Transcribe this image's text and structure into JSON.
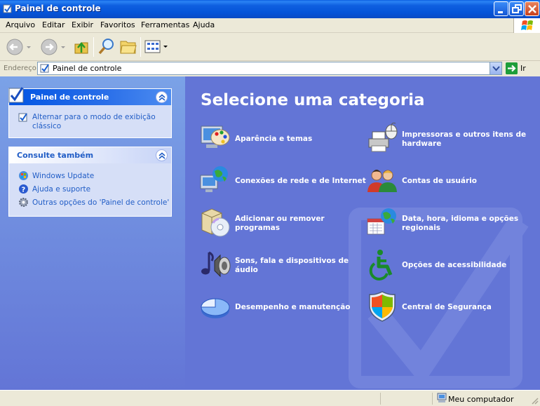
{
  "window": {
    "title": "Painel de controle",
    "icon": "control-panel-icon"
  },
  "menu": {
    "items": [
      {
        "label": "Arquivo"
      },
      {
        "label": "Editar"
      },
      {
        "label": "Exibir"
      },
      {
        "label": "Favoritos"
      },
      {
        "label": "Ferramentas"
      },
      {
        "label": "Ajuda"
      }
    ]
  },
  "toolbar": {
    "buttons": [
      "back-icon",
      "forward-icon",
      "up-folder-icon",
      "search-icon",
      "folders-icon",
      "views-icon"
    ]
  },
  "address": {
    "label": "Endereço",
    "value": "Painel de controle",
    "go_label": "Ir"
  },
  "sidebar": {
    "control_panel": {
      "title": "Painel de controle",
      "link": "Alternar para o modo de exibição clássico"
    },
    "see_also": {
      "title": "Consulte também",
      "links": [
        {
          "label": "Windows Update",
          "icon": "windows-update-icon"
        },
        {
          "label": "Ajuda e suporte",
          "icon": "help-icon"
        },
        {
          "label": "Outras opções do 'Painel de controle'",
          "icon": "gear-icon"
        }
      ]
    }
  },
  "main": {
    "heading": "Selecione uma categoria",
    "categories": [
      {
        "label": "Aparência e temas",
        "icon": "appearance-icon"
      },
      {
        "label": "Impressoras e outros itens de hardware",
        "icon": "printer-icon"
      },
      {
        "label": "Conexões de rede e de Internet",
        "icon": "network-icon"
      },
      {
        "label": "Contas de usuário",
        "icon": "user-accounts-icon"
      },
      {
        "label": "Adicionar ou remover programas",
        "icon": "add-remove-icon"
      },
      {
        "label": "Data, hora, idioma e opções regionais",
        "icon": "date-time-icon"
      },
      {
        "label": "Sons, fala e dispositivos de áudio",
        "icon": "sounds-icon"
      },
      {
        "label": "Opções de acessibilidade",
        "icon": "accessibility-icon"
      },
      {
        "label": "Desempenho e manutenção",
        "icon": "performance-icon"
      },
      {
        "label": "Central de Segurança",
        "icon": "security-center-icon"
      }
    ]
  },
  "status": {
    "location": "Meu computador"
  },
  "colors": {
    "title_bar": "#0554d8",
    "left_pane": "#7ba2e7",
    "right_pane": "#6375d6",
    "link": "#215dc6"
  }
}
